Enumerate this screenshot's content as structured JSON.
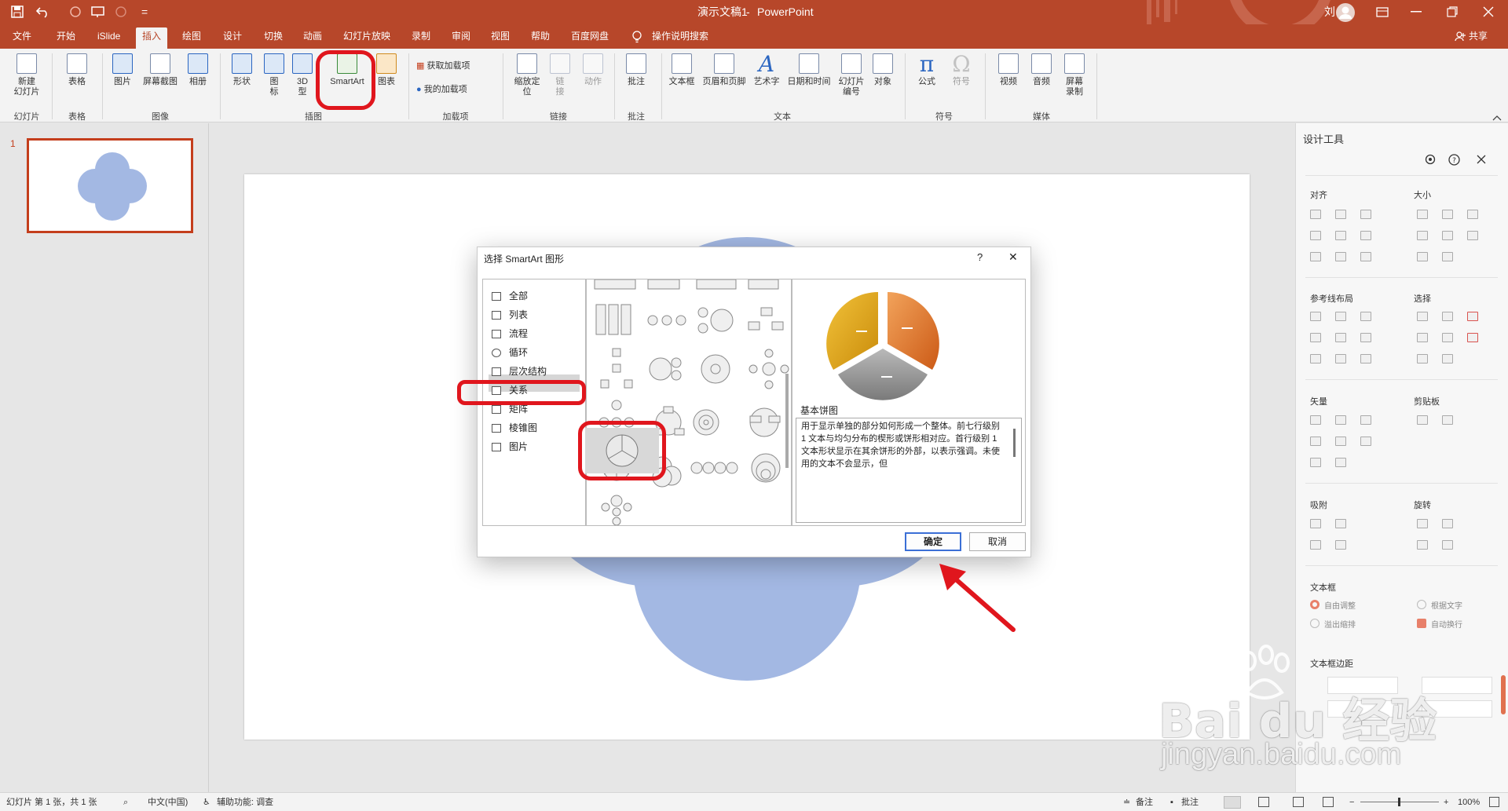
{
  "titlebar": {
    "doc_title": "演示文稿1",
    "sep": "-",
    "app_name": "PowerPoint",
    "user": "刘 玲",
    "qat_more": "=",
    "share": "共享"
  },
  "menu": {
    "tabs": [
      "文件",
      "开始",
      "iSlide",
      "插入",
      "绘图",
      "设计",
      "切换",
      "动画",
      "幻灯片放映",
      "录制",
      "审阅",
      "视图",
      "帮助",
      "百度网盘"
    ],
    "active_index": 3,
    "search": "操作说明搜索"
  },
  "ribbon": {
    "new_slide": "新建\n幻灯片",
    "table": "表格",
    "picture": "图片",
    "screenshot": "屏幕截图",
    "album": "相册",
    "shapes": "形状",
    "icons": "图\n标",
    "model3d": "3D\n型",
    "smartart": "SmartArt",
    "chart": "图表",
    "get_addins": "获取加载项",
    "my_addins": "我的加载项",
    "zoom": "缩放定\n位",
    "link": "链\n接",
    "action": "动作",
    "comment": "批注",
    "textbox": "文本框",
    "header_footer": "页眉和页脚",
    "wordart": "艺术字",
    "datetime": "日期和时间",
    "slide_num": "幻灯片\n编号",
    "object": "对象",
    "equation": "公式",
    "symbol": "符号",
    "video": "视频",
    "audio": "音频",
    "screen_rec": "屏幕\n录制",
    "groups": {
      "slides": "幻灯片",
      "tables": "表格",
      "images": "图像",
      "illustrations": "插图",
      "addins": "加载项",
      "links": "链接",
      "comments": "批注",
      "text": "文本",
      "symbols": "符号",
      "media": "媒体"
    }
  },
  "thumb": {
    "number": "1"
  },
  "dialog": {
    "title": "选择 SmartArt 图形",
    "help": "?",
    "close": "✕",
    "categories": [
      "全部",
      "列表",
      "流程",
      "循环",
      "层次结构",
      "关系",
      "矩阵",
      "棱锥图",
      "图片"
    ],
    "selected_category": 5,
    "preview_name": "基本饼图",
    "preview_desc": "用于显示单独的部分如何形成一个整体。前七行级别 1 文本与均匀分布的楔形或饼形相对应。首行级别 1 文本形状显示在其余饼形的外部，以表示强调。未使用的文本不会显示，但",
    "ok": "确定",
    "cancel": "取消"
  },
  "design_panel": {
    "title": "设计工具",
    "align": "对齐",
    "size": "大小",
    "guides": "参考线布局",
    "select": "选择",
    "vector": "矢量",
    "clipboard": "剪贴板",
    "snap": "吸附",
    "rotate": "旋转",
    "textbox": "文本框",
    "auto_fit": "自由调整",
    "fit_text": "根据文字",
    "overflow": "溢出缩排",
    "auto_wrap": "自动换行",
    "margins": "文本框边距"
  },
  "status": {
    "slide_info": "幻灯片 第 1 张，共 1 张",
    "language": "中文(中国)",
    "accessibility": "辅助功能: 调查",
    "notes": "备注",
    "comments": "批注",
    "zoom": "100%"
  },
  "watermark": {
    "brand": "Bai du 经验",
    "url": "jingyan.baidu.com"
  },
  "colors": {
    "accent": "#b7472a",
    "shape_fill": "#a3b8e3",
    "highlight_red": "#e0161d",
    "pie_orange": "#e87b2d",
    "pie_gold": "#e6a517",
    "pie_gray": "#8f8f8f"
  }
}
